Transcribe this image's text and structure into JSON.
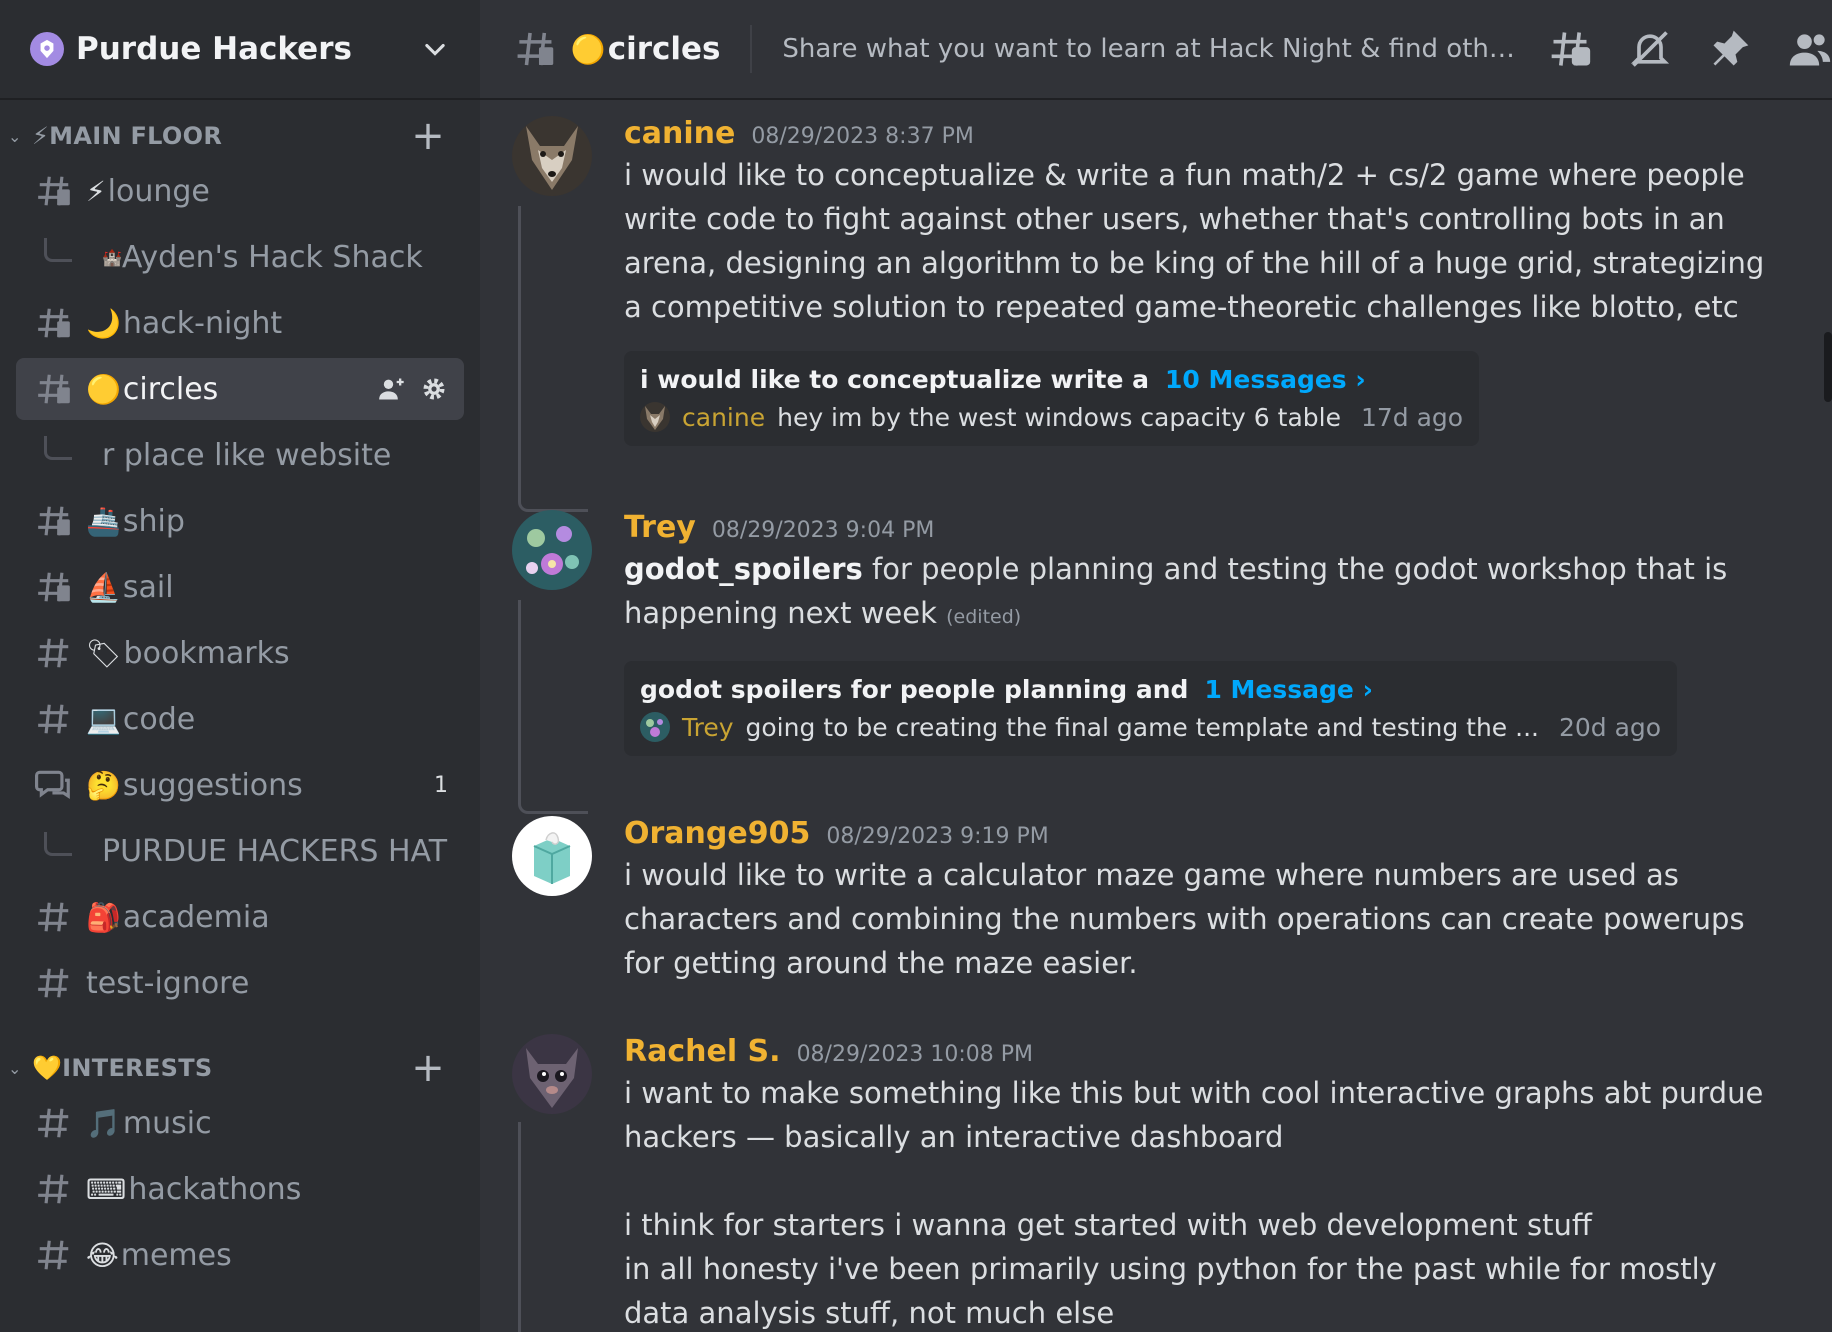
{
  "server": {
    "name": "Purdue Hackers"
  },
  "sidebar": {
    "categories": [
      {
        "label": "⚡MAIN FLOOR"
      },
      {
        "label": "💛INTERESTS"
      }
    ],
    "channels": {
      "lounge": {
        "emoji": "⚡",
        "name": "lounge"
      },
      "aydens_hack_shack": {
        "emoji": "🏰",
        "name": "Ayden's Hack Shack"
      },
      "hack_night": {
        "emoji": "🌙",
        "name": "hack-night"
      },
      "circles": {
        "emoji": "🟡",
        "name": "circles"
      },
      "r_place": {
        "name": "r place like website"
      },
      "ship": {
        "emoji": "🚢",
        "name": "ship"
      },
      "sail": {
        "emoji": "⛵",
        "name": "sail"
      },
      "bookmarks": {
        "emoji": "🏷",
        "name": "bookmarks"
      },
      "code": {
        "emoji": "💻",
        "name": "code"
      },
      "suggestions": {
        "emoji": "🤔",
        "name": "suggestions",
        "badge": "1"
      },
      "purdue_hackers_hat": {
        "name": "PURDUE HACKERS HAT"
      },
      "academia": {
        "emoji": "🎒",
        "name": "academia"
      },
      "test_ignore": {
        "name": "test-ignore"
      },
      "music": {
        "emoji": "🎵",
        "name": "music"
      },
      "hackathons": {
        "emoji": "⌨",
        "name": "hackathons"
      },
      "memes": {
        "emoji": "😂",
        "name": "memes"
      }
    }
  },
  "header": {
    "channel_emoji": "🟡",
    "channel_name": "circles",
    "topic": "Share what you want to learn at Hack Night & find others with similar interests"
  },
  "messages": [
    {
      "author": "canine",
      "timestamp": "08/29/2023 8:37 PM",
      "text": "i would like to conceptualize & write a fun math/2 + cs/2 game where people write code to fight against other users, whether that's controlling bots in an arena, designing an algorithm to be king of the hill of a huge grid, strategizing a competitive solution to repeated game-theoretic challenges like blotto, etc",
      "thread": {
        "name": "i would like to conceptualize write a",
        "count_label": "10 Messages ›",
        "last_author": "canine",
        "last_preview": "hey im by the west windows capacity 6 table",
        "ago": "17d ago"
      }
    },
    {
      "author": "Trey",
      "timestamp": "08/29/2023 9:04 PM",
      "bold": "godot_spoilers",
      "text": " for people planning and testing the godot workshop that is happening next week",
      "edited": "(edited)",
      "thread": {
        "name": "godot spoilers for people planning and",
        "count_label": "1 Message ›",
        "last_author": "Trey",
        "last_preview": "going to be creating the final game template and testing the ...",
        "ago": "20d ago"
      }
    },
    {
      "author": "Orange905",
      "timestamp": "08/29/2023 9:19 PM",
      "text": "i would like to write a calculator maze game where numbers are used as characters and combining the numbers with operations can create powerups for getting around the maze easier."
    },
    {
      "author": "Rachel S.",
      "timestamp": "08/29/2023 10:08 PM",
      "text": "i want to make something like this but with cool interactive graphs abt purdue hackers — basically an interactive dashboard",
      "text2": "i think for starters i wanna get started with web development stuff",
      "text3": "in all honesty i've been primarily using python for the past while for mostly data analysis stuff, not much else"
    }
  ],
  "colors": {
    "sidebar_bg": "#2b2d31",
    "chat_bg": "#313338",
    "username": "#f0b232",
    "link": "#00a8fc"
  },
  "icons": [
    "server-icon",
    "chevron-down-icon",
    "text-channel-icon",
    "forum-icon",
    "add-member-icon",
    "gear-icon",
    "threads-icon",
    "mute-bell-icon",
    "pin-icon",
    "members-icon"
  ]
}
